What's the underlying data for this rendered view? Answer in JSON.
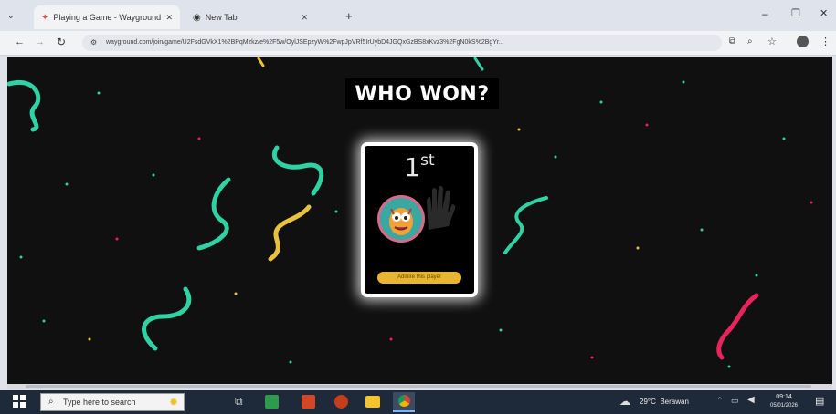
{
  "browser": {
    "tabs": [
      {
        "label": "Playing a Game - Wayground",
        "active": true
      },
      {
        "label": "New Tab",
        "active": false
      }
    ],
    "new_tab_symbol": "+",
    "url": "wayground.com/join/game/U2FsdGVkX1%2BPqMzkz/e%2F5w/OylJSEpzyW%2FwpJpVRf5IrUybD4JGQxGzBS8xKvz3%2FgN0kS%2BgYr..."
  },
  "game": {
    "title": "WHO WON?",
    "rank_number": "1",
    "rank_suffix": "st",
    "badge_label": "Admire this player"
  },
  "taskbar": {
    "search_placeholder": "Type here to search",
    "weather": "29°C  Berawan",
    "time": "09:14",
    "date": "05/01/2026"
  },
  "colors": {
    "stage_bg": "#101010",
    "confetti": [
      "#2fd3a3",
      "#e8c23a",
      "#e8245c"
    ]
  }
}
